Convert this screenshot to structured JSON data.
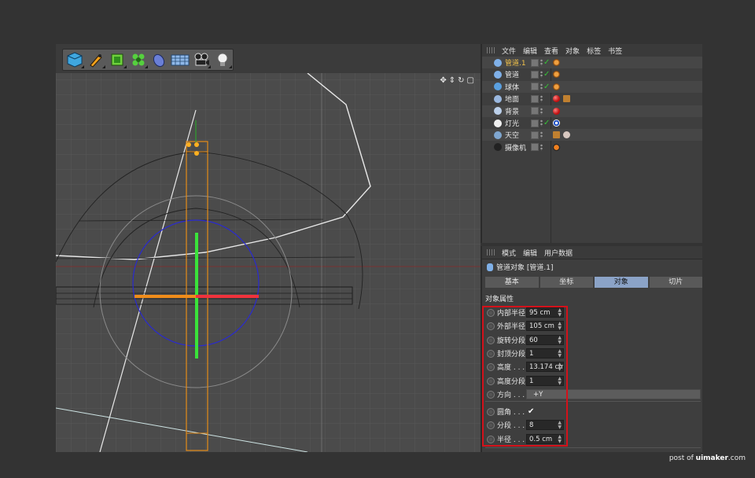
{
  "object_manager": {
    "menu": [
      "文件",
      "编辑",
      "查看",
      "对象",
      "标签",
      "书签"
    ],
    "objects": [
      {
        "name": "管道.1",
        "selected": true,
        "check": "✓",
        "icon": "tube-object-icon"
      },
      {
        "name": "管道",
        "selected": false,
        "check": "✓",
        "icon": "tube-object-icon"
      },
      {
        "name": "球体",
        "selected": false,
        "check": "✓",
        "icon": "sphere-object-icon"
      },
      {
        "name": "地面",
        "selected": false,
        "check": "",
        "icon": "floor-object-icon"
      },
      {
        "name": "背景",
        "selected": false,
        "check": "",
        "icon": "background-object-icon"
      },
      {
        "name": "灯光",
        "selected": false,
        "check": "✓",
        "icon": "light-object-icon"
      },
      {
        "name": "天空",
        "selected": false,
        "check": "",
        "icon": "sky-object-icon"
      },
      {
        "name": "摄像机",
        "selected": false,
        "check": "",
        "icon": "camera-object-icon"
      }
    ]
  },
  "attribute_manager": {
    "menu": [
      "模式",
      "编辑",
      "用户数据"
    ],
    "title": "管道对象 [管道.1]",
    "tabs": [
      {
        "label": "基本",
        "active": false
      },
      {
        "label": "坐标",
        "active": false
      },
      {
        "label": "对象",
        "active": true
      },
      {
        "label": "切片",
        "active": false
      }
    ],
    "section": "对象属性",
    "params": [
      {
        "label": "内部半径",
        "value": "95 cm"
      },
      {
        "label": "外部半径",
        "value": "105 cm"
      },
      {
        "label": "旋转分段",
        "value": "60"
      },
      {
        "label": "封顶分段",
        "value": "1"
      },
      {
        "label": "高度 . . .",
        "value": "13.174 cm"
      },
      {
        "label": "高度分段",
        "value": "1"
      },
      {
        "label": "方向 . . .",
        "value": "+Y"
      },
      {
        "label": "圆角 . . .",
        "value": "✔"
      },
      {
        "label": "分段 . . .",
        "value": "8"
      },
      {
        "label": "半径 . . .",
        "value": "0.5 cm"
      }
    ]
  },
  "viewport": {
    "nav_icons": [
      "✥",
      "⇕",
      "↻",
      "▢"
    ],
    "toolbar_icons": [
      "cube-icon",
      "pen-icon",
      "subdivision-icon",
      "cloner-icon",
      "deformer-icon",
      "floor-grid-icon",
      "camera-icon",
      "light-bulb-icon"
    ]
  },
  "credit": {
    "prefix": "post of ",
    "brand": "uimaker",
    "suffix": ".com"
  },
  "colors": {
    "accent_tab": "#8ba3c7",
    "highlight_box": "#d4111a",
    "selected_name": "#f2c24a",
    "check_green": "#36c136"
  }
}
